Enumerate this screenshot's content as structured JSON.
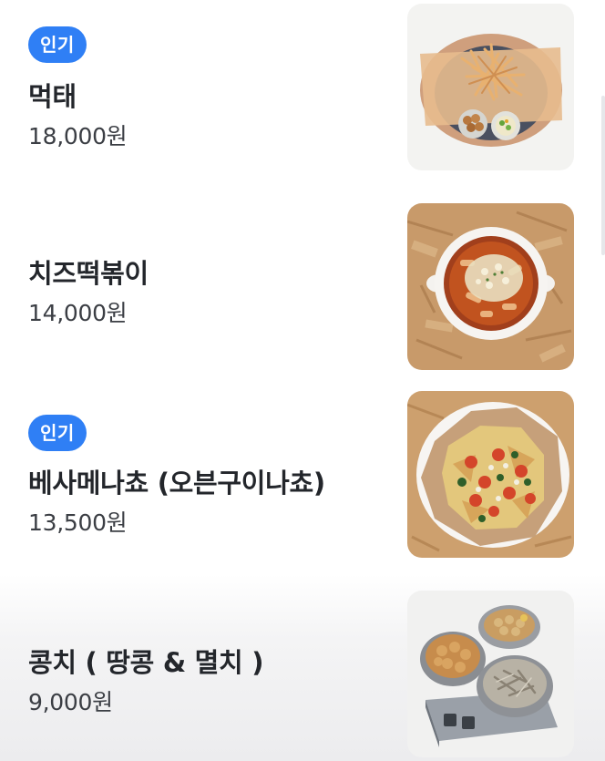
{
  "menu": {
    "items": [
      {
        "badge": "인기",
        "name": "먹태",
        "price": "18,000원",
        "image": "dried-pollack-dish"
      },
      {
        "badge": "",
        "name": "치즈떡볶이",
        "price": "14,000원",
        "image": "cheese-tteokbokki-dish"
      },
      {
        "badge": "인기",
        "name": "베사메나쵸 (오븐구이나쵸)",
        "price": "13,500원",
        "image": "oven-baked-nachos-dish"
      },
      {
        "badge": "",
        "name": "콩치 ( 땅콩 & 멸치 )",
        "price": "9,000원",
        "image": "peanuts-and-anchovies-dish"
      }
    ]
  },
  "colors": {
    "badge_background": "#2f7ff5",
    "badge_text": "#ffffff",
    "name_text": "#23262b",
    "price_text": "#3b3e44"
  }
}
